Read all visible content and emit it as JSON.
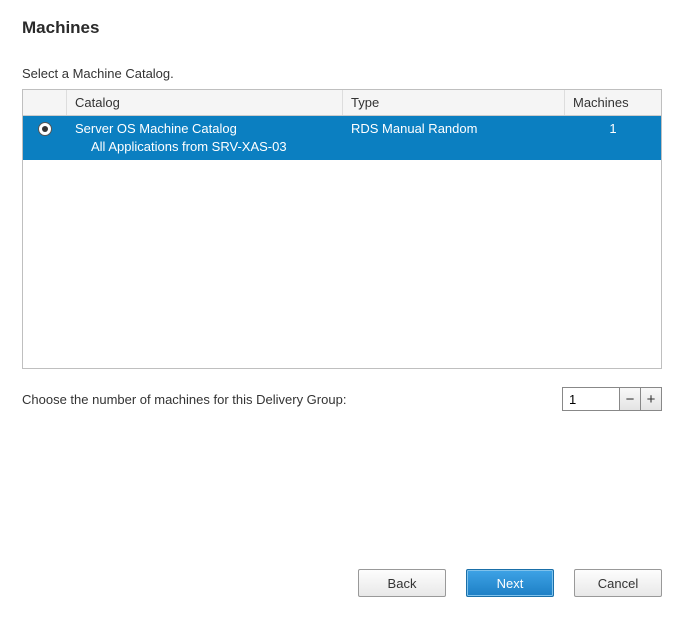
{
  "header": {
    "title": "Machines",
    "subtitle": "Select a Machine Catalog."
  },
  "table": {
    "columns": {
      "catalog": "Catalog",
      "type": "Type",
      "machines": "Machines"
    },
    "rows": [
      {
        "selected": true,
        "catalog_name": "Server OS Machine Catalog",
        "catalog_sub": "All Applications from SRV-XAS-03",
        "type": "RDS Manual Random",
        "machines": "1"
      }
    ]
  },
  "choose": {
    "label": "Choose the number of machines for this Delivery Group:",
    "value": "1",
    "minus": "−",
    "plus": "+"
  },
  "buttons": {
    "back": "Back",
    "next": "Next",
    "cancel": "Cancel"
  }
}
